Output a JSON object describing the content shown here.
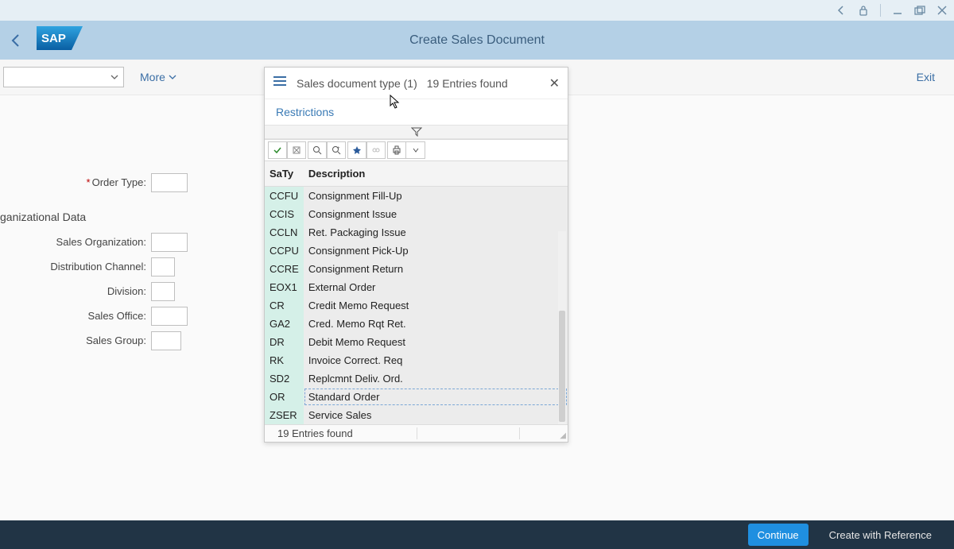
{
  "sysbar": {},
  "header": {
    "title": "Create Sales Document"
  },
  "toolbar": {
    "more_label": "More",
    "exit_label": "Exit"
  },
  "form": {
    "order_type_label": "Order Type:",
    "section_title": "ganizational Data",
    "sales_org_label": "Sales Organization:",
    "dist_channel_label": "Distribution Channel:",
    "division_label": "Division:",
    "sales_office_label": "Sales Office:",
    "sales_group_label": "Sales Group:"
  },
  "popup": {
    "title": "Sales document type (1)",
    "count_text": "19 Entries found",
    "tab_restrictions": "Restrictions",
    "status_text": "19 Entries found",
    "columns": {
      "saty": "SaTy",
      "desc": "Description"
    },
    "rows": [
      {
        "code": "CCFU",
        "desc": "Consignment Fill-Up"
      },
      {
        "code": "CCIS",
        "desc": "Consignment Issue"
      },
      {
        "code": "CCLN",
        "desc": "Ret. Packaging Issue"
      },
      {
        "code": "CCPU",
        "desc": "Consignment Pick-Up"
      },
      {
        "code": "CCRE",
        "desc": "Consignment Return"
      },
      {
        "code": "EOX1",
        "desc": "External Order"
      },
      {
        "code": "CR",
        "desc": "Credit Memo Request"
      },
      {
        "code": "GA2",
        "desc": "Cred. Memo Rqt Ret."
      },
      {
        "code": "DR",
        "desc": "Debit Memo Request"
      },
      {
        "code": "RK",
        "desc": "Invoice Correct. Req"
      },
      {
        "code": "SD2",
        "desc": "Replcmnt Deliv. Ord."
      },
      {
        "code": "OR",
        "desc": "Standard Order",
        "selected": true
      },
      {
        "code": "ZSER",
        "desc": "Service Sales"
      }
    ]
  },
  "footer": {
    "continue_label": "Continue",
    "create_ref_label": "Create with Reference"
  }
}
